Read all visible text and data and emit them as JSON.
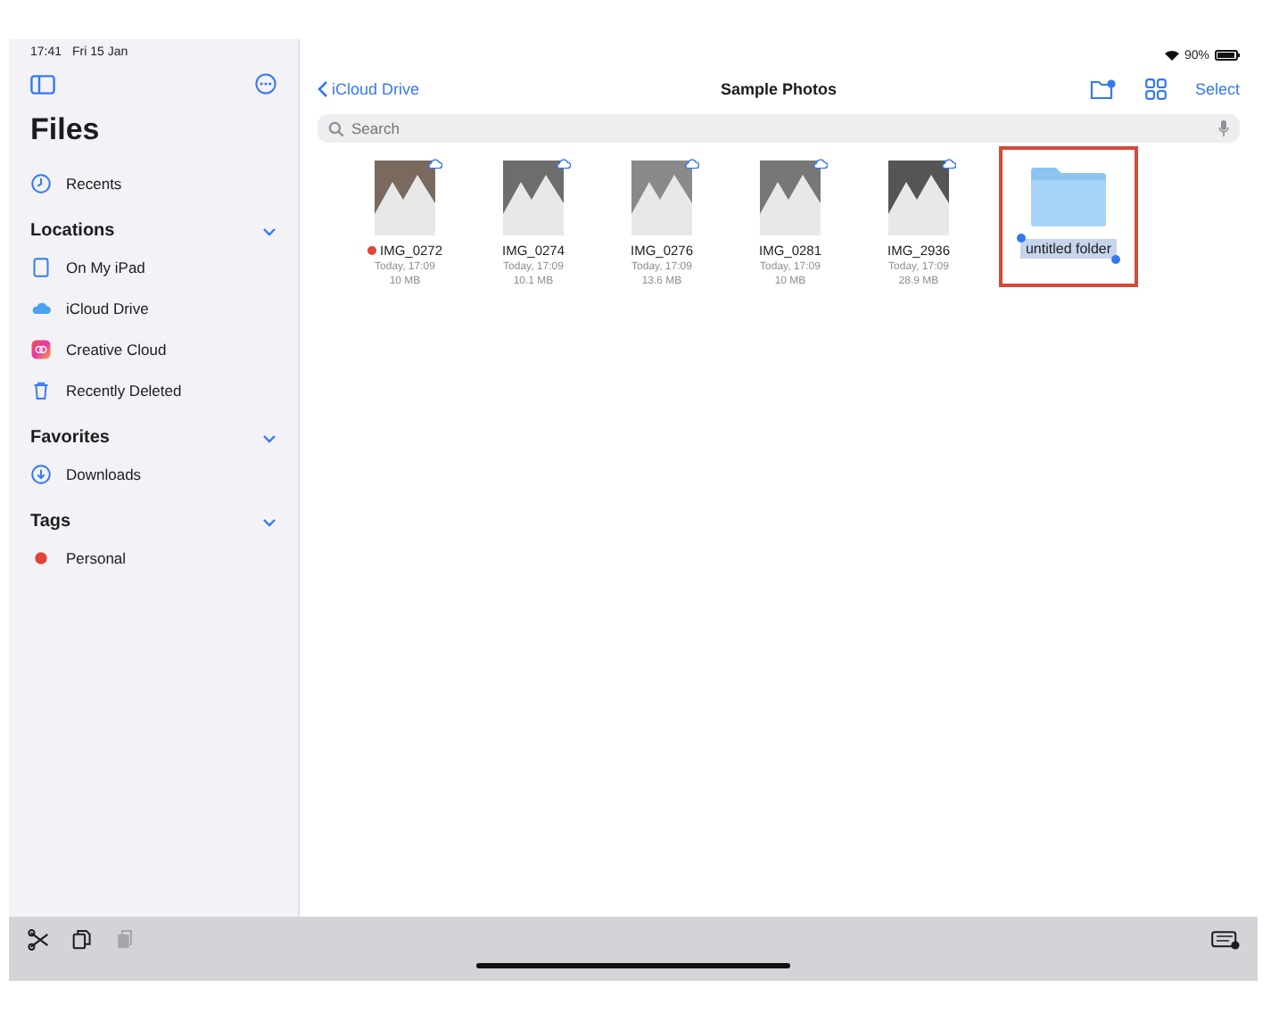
{
  "status_bar": {
    "time": "17:41",
    "date": "Fri 15 Jan",
    "battery": "90%"
  },
  "sidebar": {
    "title": "Files",
    "top_items": [
      {
        "label": "Recents",
        "kind": "clock",
        "selected": false
      }
    ],
    "sections": [
      {
        "title": "Locations",
        "expanded": true,
        "items": [
          {
            "label": "On My iPad",
            "kind": "ipad",
            "selected": false
          },
          {
            "label": "iCloud Drive",
            "kind": "cloud",
            "selected": false
          },
          {
            "label": "Creative Cloud",
            "kind": "creative",
            "selected": false
          },
          {
            "label": "Recently Deleted",
            "kind": "trash",
            "selected": false
          }
        ]
      },
      {
        "title": "Favorites",
        "expanded": true,
        "items": [
          {
            "label": "Downloads",
            "kind": "download",
            "selected": false
          }
        ]
      },
      {
        "title": "Tags",
        "expanded": true,
        "items": [
          {
            "label": "Personal",
            "kind": "tag",
            "color": "#e0443a",
            "selected": false
          }
        ]
      }
    ]
  },
  "nav": {
    "back": "iCloud Drive",
    "title": "Sample Photos",
    "select": "Select"
  },
  "search": {
    "placeholder": "Search"
  },
  "files": [
    {
      "kind": "photo",
      "name": "IMG_0272",
      "date": "Today, 17:09",
      "size": "10 MB",
      "color": "#e0443a"
    },
    {
      "kind": "photo",
      "name": "IMG_0274",
      "date": "Today, 17:09",
      "size": "10.1 MB"
    },
    {
      "kind": "photo",
      "name": "IMG_0276",
      "date": "Today, 17:09",
      "size": "13.6 MB"
    },
    {
      "kind": "photo",
      "name": "IMG_0281",
      "date": "Today, 17:09",
      "size": "10 MB"
    },
    {
      "kind": "photo",
      "name": "IMG_2936",
      "date": "Today, 17:09",
      "size": "28.9 MB"
    },
    {
      "kind": "folder",
      "name": "untitled folder",
      "editing": true,
      "highlighted": true
    }
  ],
  "toolbar": [
    {
      "kind": "cut",
      "disabled": false
    },
    {
      "kind": "copy",
      "disabled": false
    },
    {
      "kind": "paste",
      "disabled": true
    }
  ]
}
